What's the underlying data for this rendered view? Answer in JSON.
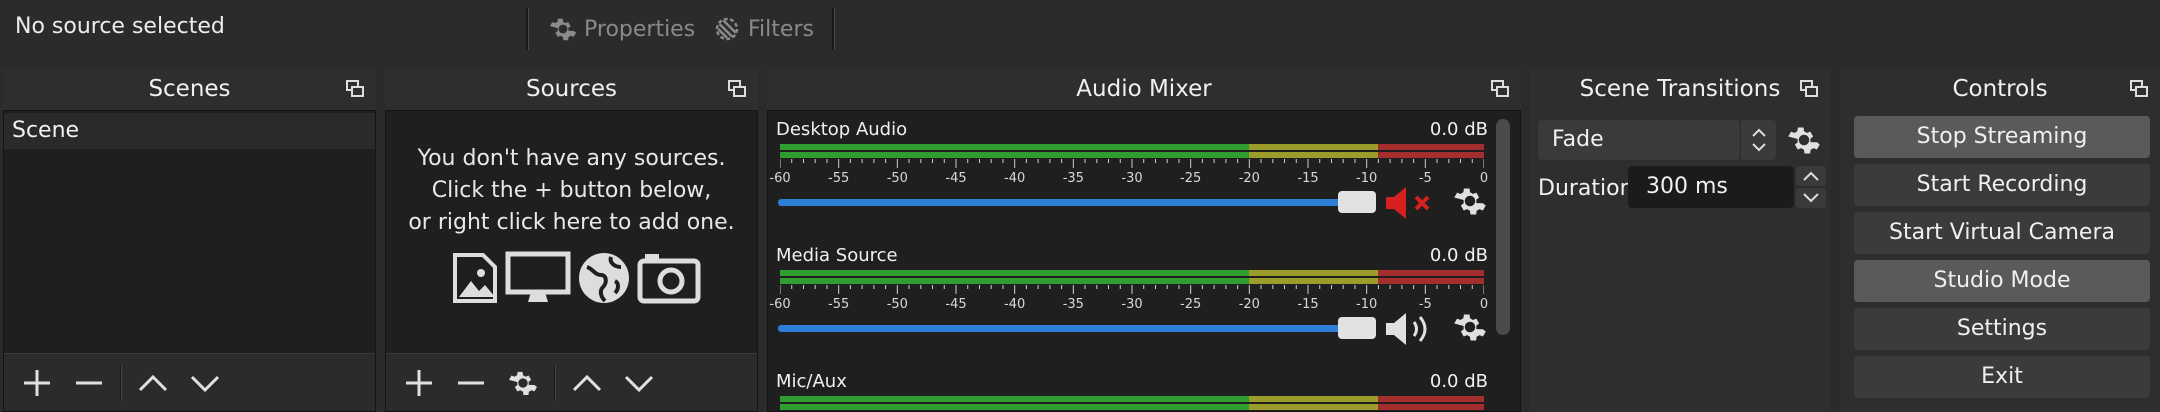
{
  "topbar": {
    "source_label": "No source selected",
    "properties_label": "Properties",
    "filters_label": "Filters"
  },
  "scenes": {
    "title": "Scenes",
    "items": [
      "Scene"
    ]
  },
  "sources": {
    "title": "Sources",
    "empty_line1": "You don't have any sources.",
    "empty_line2": "Click the + button below,",
    "empty_line3": "or right click here to add one."
  },
  "mixer": {
    "title": "Audio Mixer",
    "tick_labels": [
      "-60",
      "-55",
      "-50",
      "-45",
      "-40",
      "-35",
      "-30",
      "-25",
      "-20",
      "-15",
      "-10",
      "-5",
      "0"
    ],
    "channels": [
      {
        "name": "Desktop Audio",
        "db": "0.0 dB",
        "muted": true
      },
      {
        "name": "Media Source",
        "db": "0.0 dB",
        "muted": false
      },
      {
        "name": "Mic/Aux",
        "db": "0.0 dB",
        "muted": false
      }
    ],
    "colors": {
      "green": "#2f9d2f",
      "yellow": "#9c9c2a",
      "red": "#a42d2d",
      "slider": "#2c7ed6",
      "mute": "#d82020"
    }
  },
  "transitions": {
    "title": "Scene Transitions",
    "selected": "Fade",
    "duration_label": "Duration",
    "duration_value": "300 ms"
  },
  "controls": {
    "title": "Controls",
    "buttons": [
      "Stop Streaming",
      "Start Recording",
      "Start Virtual Camera",
      "Studio Mode",
      "Settings",
      "Exit"
    ]
  }
}
